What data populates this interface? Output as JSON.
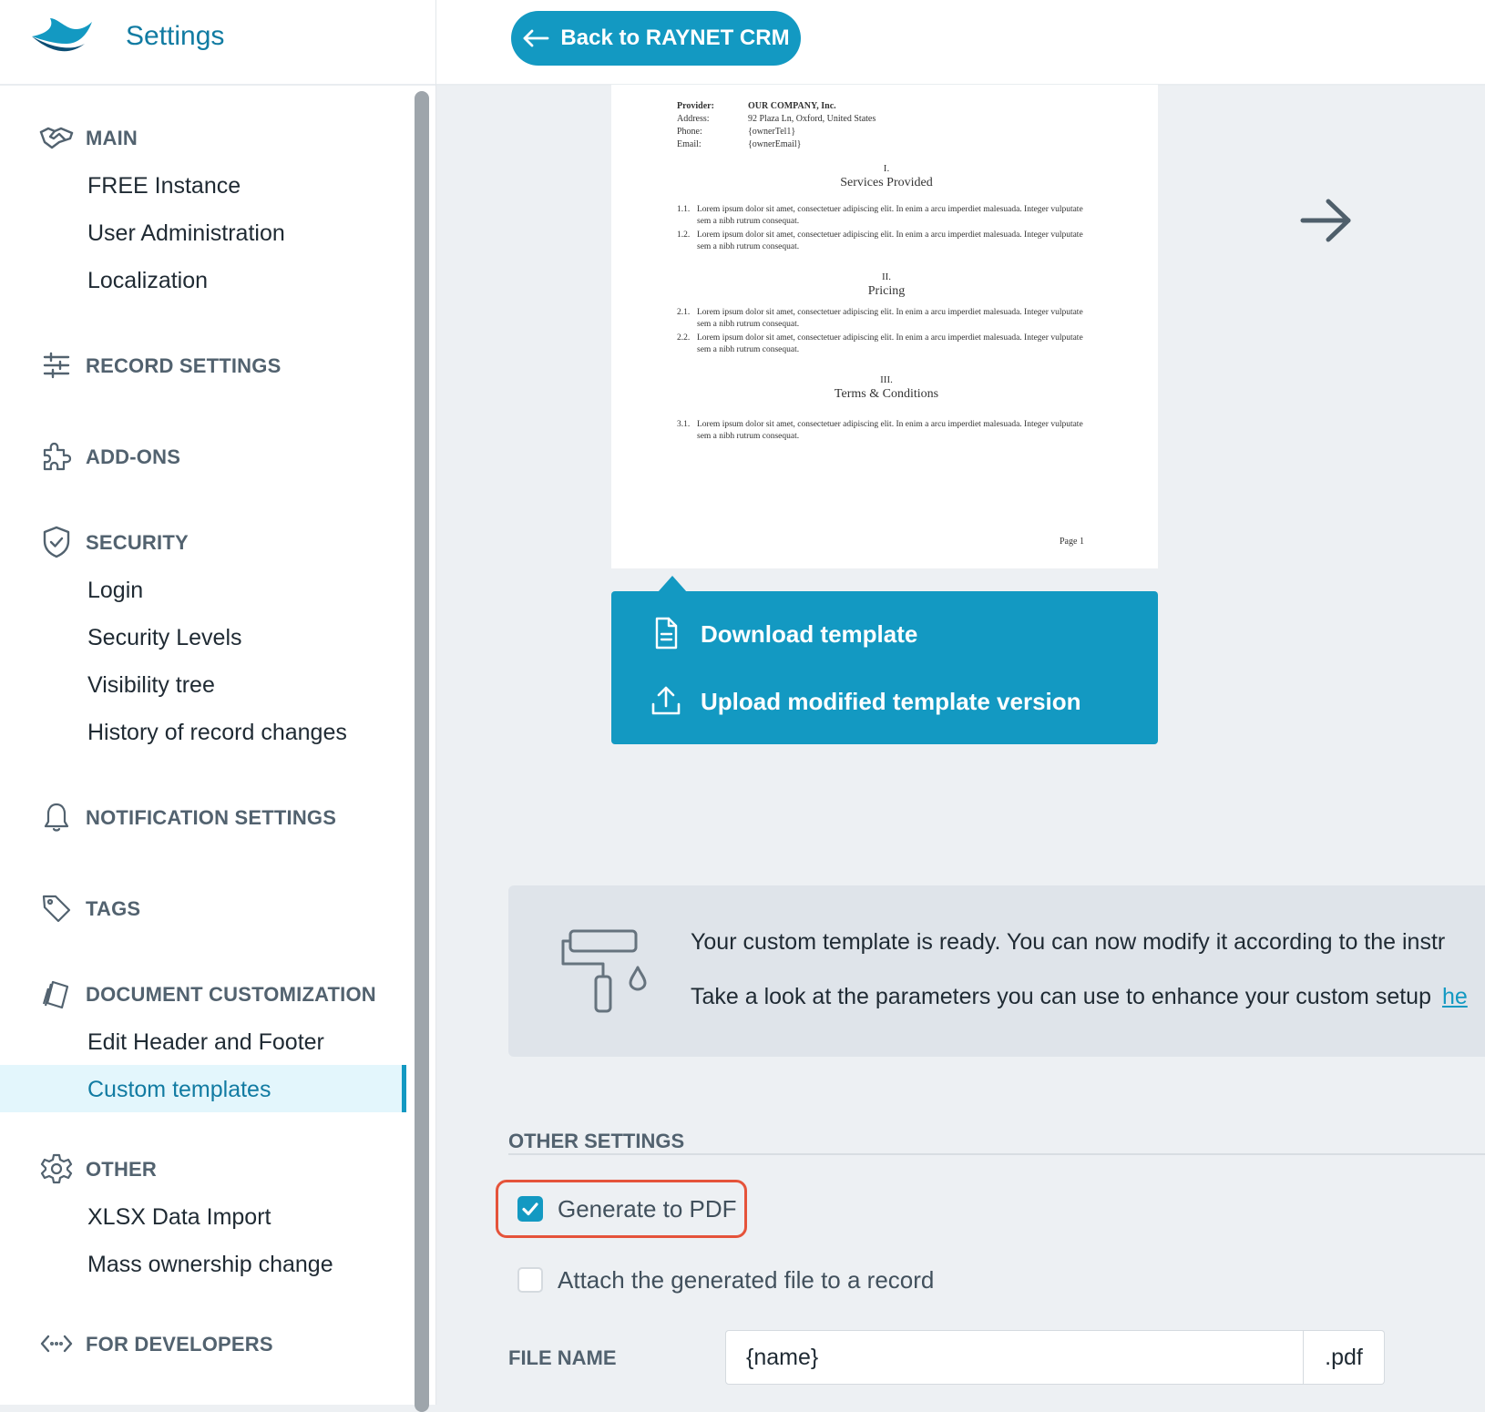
{
  "app": {
    "title": "Settings"
  },
  "colors": {
    "accent": "#1399c2",
    "highlight": "#e5533a",
    "section_text": "#52626f"
  },
  "sidebar": {
    "sections": [
      {
        "label": "MAIN",
        "icon": "handshake-icon",
        "items": [
          "FREE Instance",
          "User Administration",
          "Localization"
        ]
      },
      {
        "label": "RECORD SETTINGS",
        "icon": "sliders-icon",
        "items": []
      },
      {
        "label": "ADD-ONS",
        "icon": "puzzle-icon",
        "items": []
      },
      {
        "label": "SECURITY",
        "icon": "shield-check-icon",
        "items": [
          "Login",
          "Security Levels",
          "Visibility tree",
          "History of record changes"
        ]
      },
      {
        "label": "NOTIFICATION SETTINGS",
        "icon": "bell-icon",
        "items": []
      },
      {
        "label": "TAGS",
        "icon": "tag-icon",
        "items": []
      },
      {
        "label": "DOCUMENT CUSTOMIZATION",
        "icon": "document-stack-icon",
        "items": [
          "Edit Header and Footer",
          "Custom templates"
        ]
      },
      {
        "label": "OTHER",
        "icon": "gear-icon",
        "items": [
          "XLSX Data Import",
          "Mass ownership change"
        ]
      },
      {
        "label": "FOR DEVELOPERS",
        "icon": "code-icon",
        "items": []
      }
    ],
    "active_item": "Custom templates"
  },
  "topbar": {
    "back_label": "Back to RAYNET CRM"
  },
  "preview": {
    "meta": [
      {
        "key": "Provider:",
        "value": "OUR COMPANY, Inc."
      },
      {
        "key": "Address:",
        "value": "92 Plaza Ln,  Oxford, United States"
      },
      {
        "key": "Phone:",
        "value": "{ownerTel1}"
      },
      {
        "key": "Email:",
        "value": "{ownerEmail}"
      }
    ],
    "sections": [
      {
        "numeral": "I.",
        "title": "Services Provided",
        "clauses": [
          {
            "num": "1.1.",
            "text": "Lorem ipsum dolor sit amet, consectetuer adipiscing elit. In enim a arcu imperdiet malesuada. Integer vulputate sem a nibh rutrum consequat."
          },
          {
            "num": "1.2.",
            "text": "Lorem ipsum dolor sit amet, consectetuer adipiscing elit. In enim a arcu imperdiet malesuada. Integer vulputate sem a nibh rutrum consequat."
          }
        ]
      },
      {
        "numeral": "II.",
        "title": "Pricing",
        "clauses": [
          {
            "num": "2.1.",
            "text": "Lorem ipsum dolor sit amet, consectetuer adipiscing elit. In enim a arcu imperdiet malesuada. Integer vulputate sem a nibh rutrum consequat."
          },
          {
            "num": "2.2.",
            "text": "Lorem ipsum dolor sit amet, consectetuer adipiscing elit. In enim a arcu imperdiet malesuada. Integer vulputate sem a nibh rutrum consequat."
          }
        ]
      },
      {
        "numeral": "III.",
        "title": "Terms & Conditions",
        "clauses": [
          {
            "num": "3.1.",
            "text": "Lorem ipsum dolor sit amet, consectetuer adipiscing elit. In enim a arcu imperdiet malesuada. Integer vulputate sem a nibh rutrum consequat."
          }
        ]
      }
    ],
    "page_label": "Page 1"
  },
  "template_actions": {
    "download_label": "Download template",
    "upload_label": "Upload modified template version"
  },
  "info": {
    "line1": "Your custom template is ready. You can now modify it according to the instr",
    "line2": "Take a look at the parameters you can use to enhance your custom setup",
    "link": "he"
  },
  "other_settings": {
    "heading": "OTHER SETTINGS",
    "generate_pdf": {
      "label": "Generate to PDF",
      "checked": true
    },
    "attach_file": {
      "label": "Attach the generated file to a record",
      "checked": false
    },
    "file_name": {
      "label": "FILE NAME",
      "value": "{name}",
      "suffix": ".pdf"
    }
  }
}
